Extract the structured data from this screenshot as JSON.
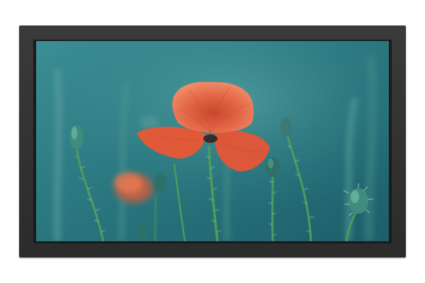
{
  "scene": {
    "subject": "display-monitor",
    "screen_content": "poppy-flower-photo",
    "colors": {
      "bezel": "#2e2e2e",
      "background": "#ffffff",
      "screen_teal": "#2f7f86",
      "poppy_red": "#e4603f",
      "stem_green": "#4f9a5d"
    }
  }
}
